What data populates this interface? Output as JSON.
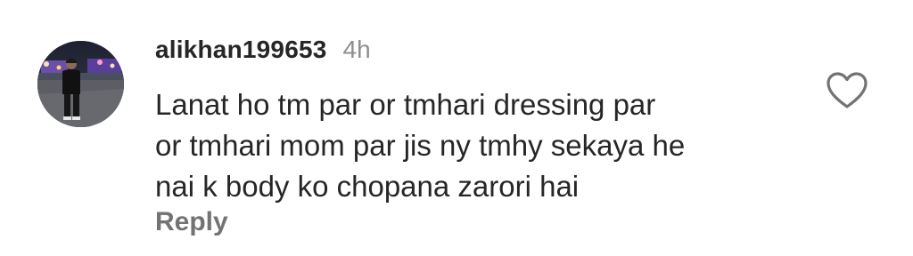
{
  "comment": {
    "username": "alikhan199653",
    "timestamp": "4h",
    "text_lines": [
      "Lanat ho tm par or tmhari dressing par",
      "or tmhari mom par jis ny tmhy sekaya he",
      "nai k body ko chopana zarori hai"
    ],
    "reply_label": "Reply",
    "like_icon": "heart-outline-icon",
    "avatar_icon": "user-photo-avatar"
  },
  "colors": {
    "text_primary": "#262626",
    "text_secondary": "#8e8e8e",
    "reply": "#737373"
  }
}
